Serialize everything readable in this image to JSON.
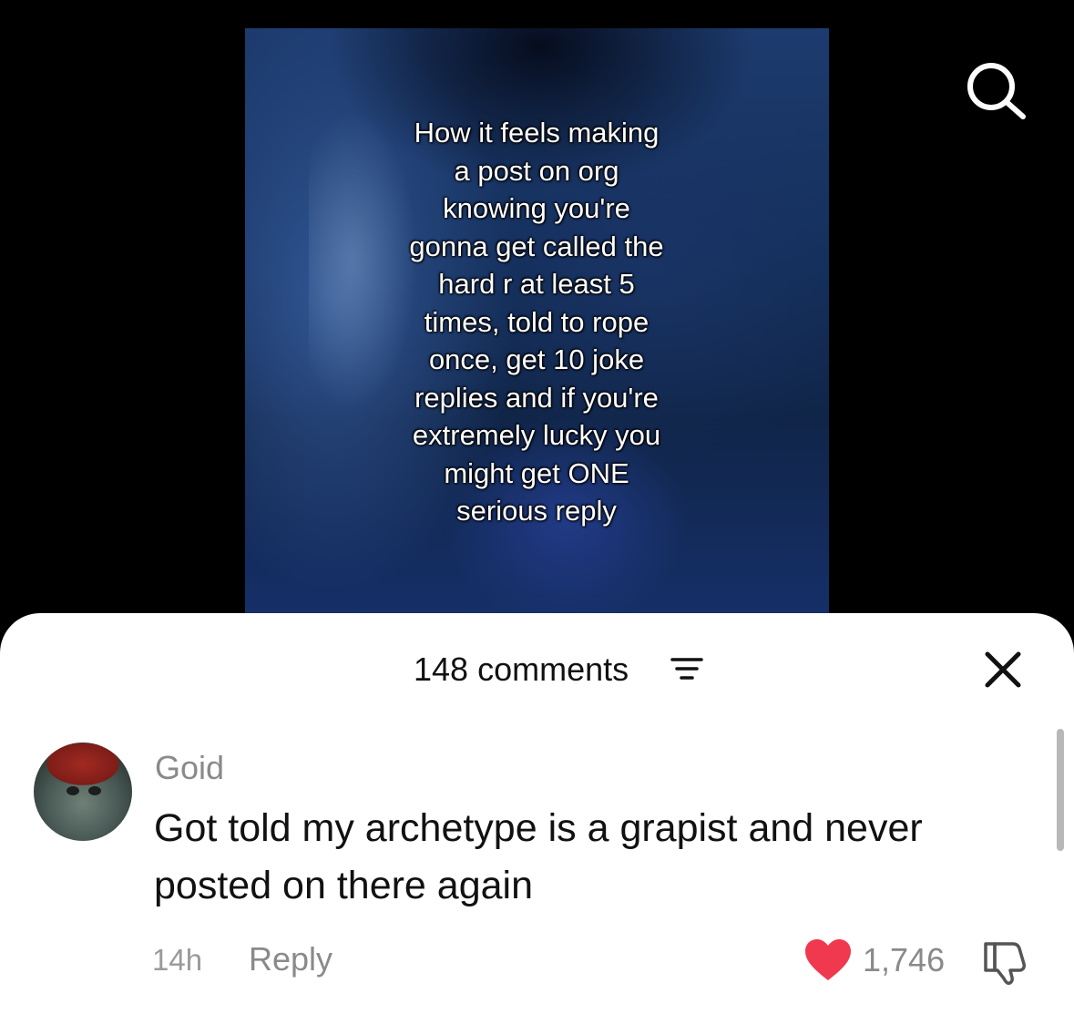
{
  "video": {
    "caption": "How it feels making\na post on org\nknowing you're\ngonna get called the\nhard r at least 5\ntimes, told to rope\nonce, get 10 joke\nreplies and if you're\nextremely lucky you\nmight get ONE\nserious reply"
  },
  "icons": {
    "search": "search-icon",
    "filter": "filter-icon",
    "close": "close-icon",
    "like": "heart-icon",
    "dislike": "thumbs-down-icon"
  },
  "colors": {
    "like": "#f0384f",
    "muted_text": "#8a8a8a",
    "sheet_bg": "#ffffff"
  },
  "comments_sheet": {
    "title": "148 comments"
  },
  "comment": {
    "username": "Goid",
    "text": "Got told my archetype is a grapist and never posted on there again",
    "time": "14h",
    "reply_label": "Reply",
    "likes": "1,746"
  }
}
